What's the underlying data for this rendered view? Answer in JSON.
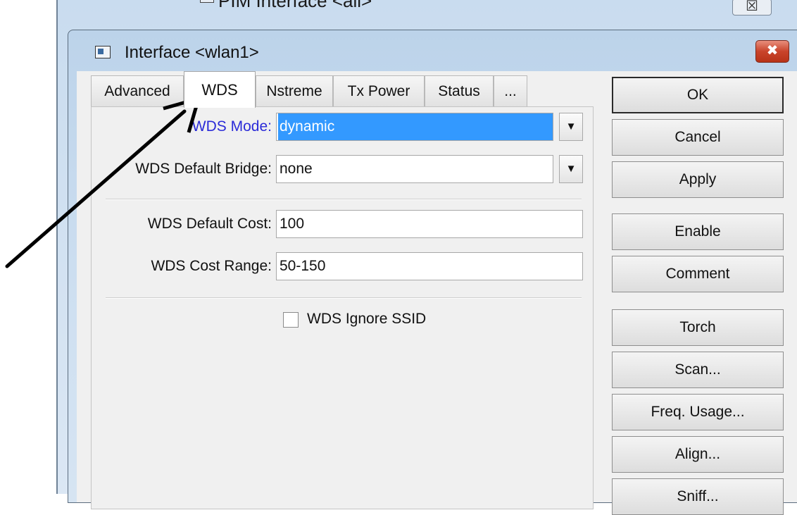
{
  "background_window": {
    "title": "PIM Interface <all>",
    "close_symbol": "☒"
  },
  "dialog": {
    "title": "Interface <wlan1>",
    "close_symbol": "✖",
    "icon": "window-icon"
  },
  "tabs": [
    {
      "label": "Advanced",
      "active": false
    },
    {
      "label": "WDS",
      "active": true
    },
    {
      "label": "Nstreme",
      "active": false
    },
    {
      "label": "Tx Power",
      "active": false
    },
    {
      "label": "Status",
      "active": false
    },
    {
      "label": "...",
      "active": false
    }
  ],
  "form": {
    "wds_mode": {
      "label": "WDS Mode:",
      "value": "dynamic"
    },
    "wds_default_bridge": {
      "label": "WDS Default Bridge:",
      "value": "none"
    },
    "wds_default_cost": {
      "label": "WDS Default Cost:",
      "value": "100"
    },
    "wds_cost_range": {
      "label": "WDS Cost Range:",
      "value": "50-150"
    },
    "wds_ignore_ssid": {
      "label": "WDS Ignore SSID",
      "checked": false
    },
    "dropdown_symbol": "▼"
  },
  "buttons": [
    {
      "label": "OK",
      "default": true
    },
    {
      "label": "Cancel"
    },
    {
      "label": "Apply"
    },
    {
      "label": "Enable"
    },
    {
      "label": "Comment"
    },
    {
      "label": "Torch"
    },
    {
      "label": "Scan..."
    },
    {
      "label": "Freq. Usage..."
    },
    {
      "label": "Align..."
    },
    {
      "label": "Sniff..."
    }
  ],
  "colors": {
    "selection": "#3399ff",
    "label_highlight": "#2b2bd8",
    "close_red": "#c9442b"
  }
}
